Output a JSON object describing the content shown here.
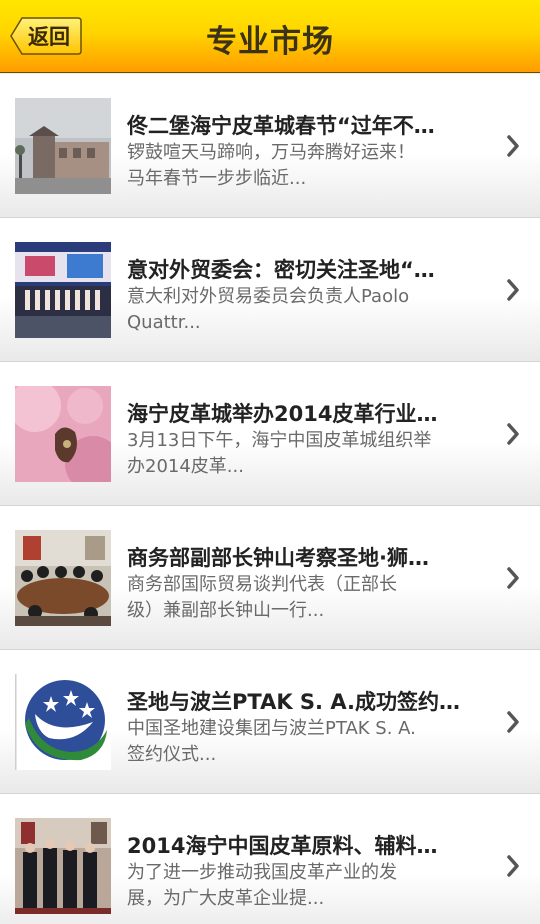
{
  "header": {
    "back_label": "返回",
    "title": "专业市场"
  },
  "articles": [
    {
      "title": "佟二堡海宁皮革城春节“过年不…",
      "desc_line1": "锣鼓喧天马蹄响，万马奔腾好运来！",
      "desc_line2": "马年春节一步步临近..."
    },
    {
      "title": "意对外贸委会：密切关注圣地“…",
      "desc_line1": "意大利对外贸易委员会负责人Paolo",
      "desc_line2": "Quattr..."
    },
    {
      "title": "海宁皮革城举办2014皮革行业…",
      "desc_line1": "3月13日下午，海宁中国皮革城组织举",
      "desc_line2": "办2014皮革..."
    },
    {
      "title": "商务部副部长钟山考察圣地·狮…",
      "desc_line1": "商务部国际贸易谈判代表（正部长",
      "desc_line2": "级）兼副部长钟山一行..."
    },
    {
      "title": "圣地与波兰PTAK S. A.成功签约…",
      "desc_line1": "中国圣地建设集团与波兰PTAK S. A.",
      "desc_line2": "签约仪式..."
    },
    {
      "title": "2014海宁中国皮革原料、辅料…",
      "desc_line1": "为了进一步推动我国皮革产业的发",
      "desc_line2": "展，为广大皮革企业提..."
    }
  ]
}
